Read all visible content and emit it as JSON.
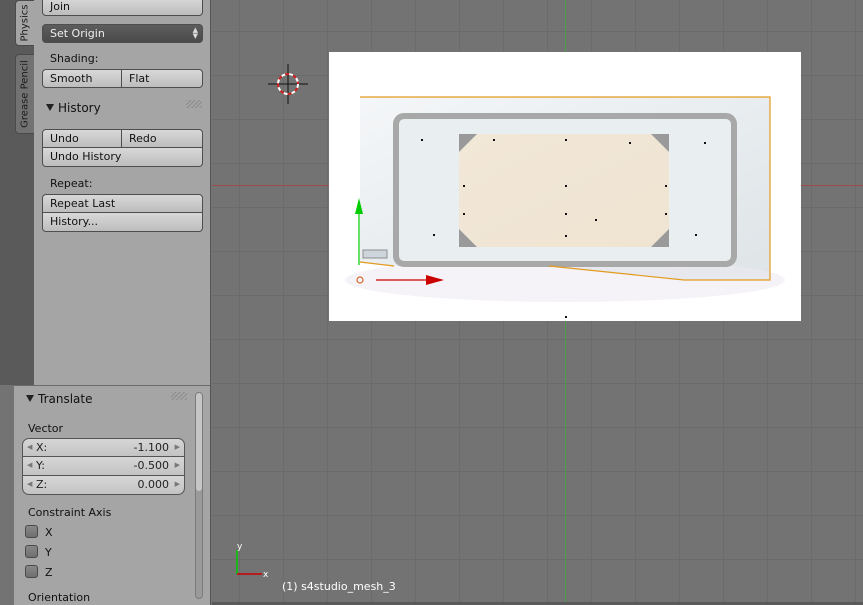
{
  "tool_tabs": [
    "Physics",
    "Grease Pencil"
  ],
  "tool_shelf": {
    "join_label": "Join",
    "set_origin": {
      "selected": "Set Origin"
    },
    "shading": {
      "label": "Shading:",
      "smooth": "Smooth",
      "flat": "Flat"
    },
    "history": {
      "title": "History",
      "undo": "Undo",
      "redo": "Redo",
      "undo_history": "Undo History",
      "repeat_label": "Repeat:",
      "repeat_last": "Repeat Last",
      "history_menu": "History..."
    }
  },
  "operator_panel": {
    "title": "Translate",
    "vector_label": "Vector",
    "vector": [
      {
        "axis": "X:",
        "value": "-1.100"
      },
      {
        "axis": "Y:",
        "value": "-0.500"
      },
      {
        "axis": "Z:",
        "value": "0.000"
      }
    ],
    "constraint_label": "Constraint Axis",
    "constraints": [
      {
        "label": "X",
        "checked": false
      },
      {
        "label": "Y",
        "checked": false
      },
      {
        "label": "Z",
        "checked": false
      }
    ],
    "orientation_label": "Orientation"
  },
  "viewport": {
    "object_label": "(1) s4studio_mesh_3",
    "mini_axis": {
      "x": "x",
      "y": "y"
    },
    "colors": {
      "x_axis": "#cc0000",
      "y_axis": "#00cc00",
      "selection": "#e39a1e"
    }
  }
}
